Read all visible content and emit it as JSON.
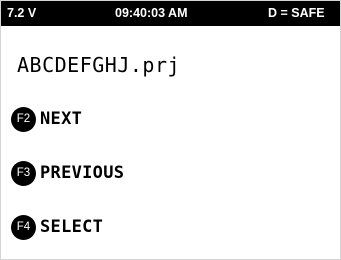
{
  "status_bar": {
    "voltage": "7.2 V",
    "time": "09:40:03 AM",
    "mode": "D = SAFE"
  },
  "file": {
    "name": "ABCDEFGHJ.prj"
  },
  "menu": {
    "items": [
      {
        "key": "F2",
        "label": "NEXT"
      },
      {
        "key": "F3",
        "label": "PREVIOUS"
      },
      {
        "key": "F4",
        "label": "SELECT"
      }
    ]
  },
  "colors": {
    "background": "#ffffff",
    "status_bar": "#000000",
    "text": "#000000",
    "badge": "#000000"
  }
}
